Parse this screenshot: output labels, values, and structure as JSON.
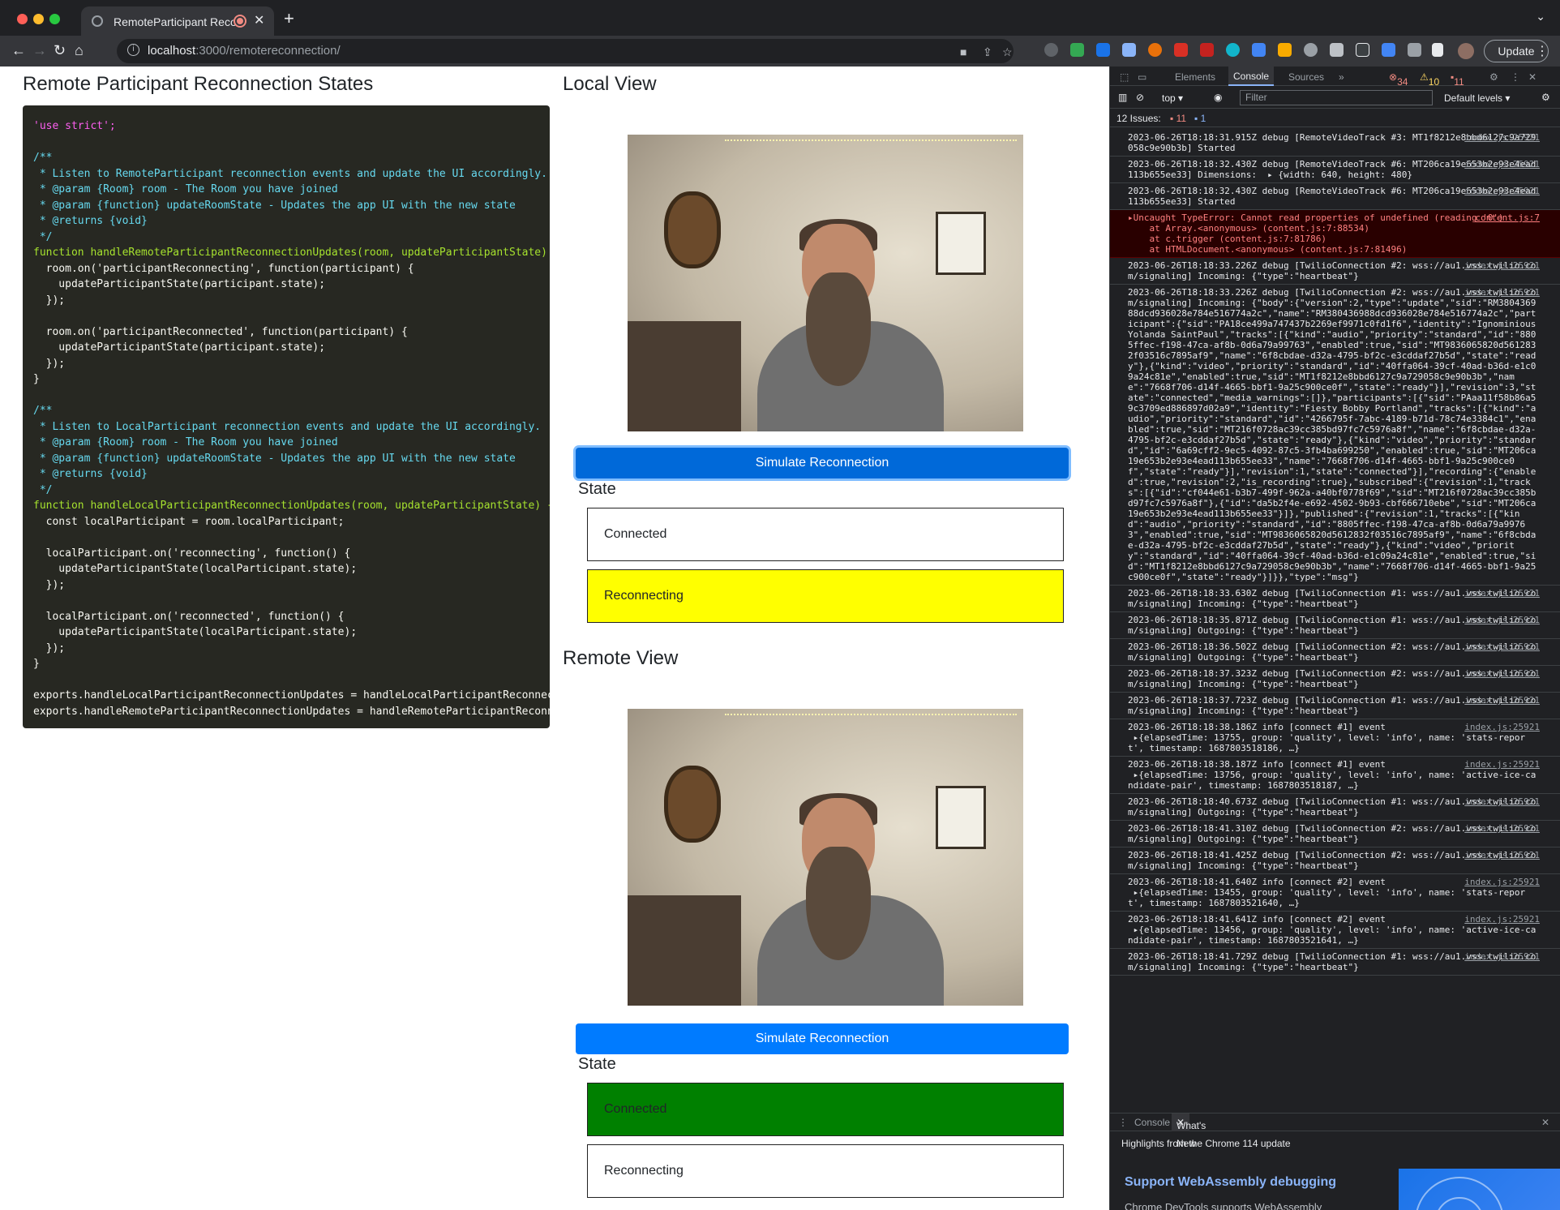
{
  "browser": {
    "tab_title": "RemoteParticipant Reconnection",
    "url_host": "localhost",
    "url_path": ":3000/remotereconnection/",
    "update_label": "Update"
  },
  "page": {
    "title": "Remote Participant Reconnection States",
    "code_lines": [
      "'use strict';",
      "",
      "/**",
      " * Listen to RemoteParticipant reconnection events and update the UI accordingly.",
      " * @param {Room} room - The Room you have joined",
      " * @param {function} updateRoomState - Updates the app UI with the new state",
      " * @returns {void}",
      " */",
      "function handleRemoteParticipantReconnectionUpdates(room, updateParticipantState) {",
      "  room.on('participantReconnecting', function(participant) {",
      "    updateParticipantState(participant.state);",
      "  });",
      "",
      "  room.on('participantReconnected', function(participant) {",
      "    updateParticipantState(participant.state);",
      "  });",
      "}",
      "",
      "/**",
      " * Listen to LocalParticipant reconnection events and update the UI accordingly.",
      " * @param {Room} room - The Room you have joined",
      " * @param {function} updateRoomState - Updates the app UI with the new state",
      " * @returns {void}",
      " */",
      "function handleLocalParticipantReconnectionUpdates(room, updateParticipantState) {",
      "  const localParticipant = room.localParticipant;",
      "",
      "  localParticipant.on('reconnecting', function() {",
      "    updateParticipantState(localParticipant.state);",
      "  });",
      "",
      "  localParticipant.on('reconnected', function() {",
      "    updateParticipantState(localParticipant.state);",
      "  });",
      "}",
      "",
      "exports.handleLocalParticipantReconnectionUpdates = handleLocalParticipantReconnectionUpdates;",
      "exports.handleRemoteParticipantReconnectionUpdates = handleRemoteParticipantReconnectionUpdates;"
    ],
    "local": {
      "heading": "Local View",
      "button": "Simulate Reconnection",
      "state_label": "State",
      "states": [
        {
          "label": "Connected",
          "color": "#ffffff"
        },
        {
          "label": "Reconnecting",
          "color": "#ffff00"
        }
      ]
    },
    "remote": {
      "heading": "Remote View",
      "button": "Simulate Reconnection",
      "state_label": "State",
      "states": [
        {
          "label": "Connected",
          "color": "#008000"
        },
        {
          "label": "Reconnecting",
          "color": "#ffffff"
        }
      ]
    }
  },
  "devtools": {
    "tabs": [
      "Elements",
      "Console",
      "Sources"
    ],
    "active_tab": "Console",
    "errors_count": "34",
    "warnings_count": "10",
    "issues_badge": "11",
    "context": "top",
    "filter_placeholder": "Filter",
    "levels": "Default levels",
    "issues_label": "12 Issues:",
    "issues_err": "11",
    "issues_info": "1",
    "logs": [
      {
        "text": "2023-06-26T18:18:31.915Z debug [RemoteVideoTrack #3: MT1f8212e8bbd6127c9a729058c9e90b3b] Started",
        "src": "index.js:25921",
        "type": "log"
      },
      {
        "text": "2023-06-26T18:18:32.430Z debug [RemoteVideoTrack #6: MT206ca19e653b2e93e4ead113b655ee33] Dimensions:  ▸ {width: 640, height: 480}",
        "src": "index.js:25921",
        "type": "log"
      },
      {
        "text": "2023-06-26T18:18:32.430Z debug [RemoteVideoTrack #6: MT206ca19e653b2e93e4ead113b655ee33] Started",
        "src": "index.js:25921",
        "type": "log"
      },
      {
        "text": "▸Uncaught TypeError: Cannot read properties of undefined (reading '0')\n    at Array.<anonymous> (content.js:7:88534)\n    at c.trigger (content.js:7:81786)\n    at HTMLDocument.<anonymous> (content.js:7:81496)",
        "src": "content.js:7",
        "type": "err"
      },
      {
        "text": "2023-06-26T18:18:33.226Z debug [TwilioConnection #2: wss://au1.vss.twilio.com/signaling] Incoming: {\"type\":\"heartbeat\"}",
        "src": "index.js:25921",
        "type": "log"
      },
      {
        "text": "2023-06-26T18:18:33.226Z debug [TwilioConnection #2: wss://au1.vss.twilio.com/signaling] Incoming: {\"body\":{\"version\":2,\"type\":\"update\",\"sid\":\"RM380436988dcd936028e784e516774a2c\",\"name\":\"RM380436988dcd936028e784e516774a2c\",\"participant\":{\"sid\":\"PA18ce499a747437b2269ef9971c0fd1f6\",\"identity\":\"Ignominious Yolanda SaintPaul\",\"tracks\":[{\"kind\":\"audio\",\"priority\":\"standard\",\"id\":\"8805ffec-f198-47ca-af8b-0d6a79a99763\",\"enabled\":true,\"sid\":\"MT9836065820d5612832f03516c7895af9\",\"name\":\"6f8cbdae-d32a-4795-bf2c-e3cddaf27b5d\",\"state\":\"ready\"},{\"kind\":\"video\",\"priority\":\"standard\",\"id\":\"40ffa064-39cf-40ad-b36d-e1c09a24c81e\",\"enabled\":true,\"sid\":\"MT1f8212e8bbd6127c9a729058c9e90b3b\",\"name\":\"7668f706-d14f-4665-bbf1-9a25c900ce0f\",\"state\":\"ready\"}],\"revision\":3,\"state\":\"connected\",\"media_warnings\":[]},\"participants\":[{\"sid\":\"PAaa11f58b86a59c3709ed886897d02a9\",\"identity\":\"Fiesty Bobby Portland\",\"tracks\":[{\"kind\":\"audio\",\"priority\":\"standard\",\"id\":\"4266795f-7abc-4189-b71d-78c74e3384c1\",\"enabled\":true,\"sid\":\"MT216f0728ac39cc385bd97fc7c5976a8f\",\"name\":\"6f8cbdae-d32a-4795-bf2c-e3cddaf27b5d\",\"state\":\"ready\"},{\"kind\":\"video\",\"priority\":\"standard\",\"id\":\"6a69cff2-9ec5-4092-87c5-3fb4ba699250\",\"enabled\":true,\"sid\":\"MT206ca19e653b2e93e4ead113b655ee33\",\"name\":\"7668f706-d14f-4665-bbf1-9a25c900ce0f\",\"state\":\"ready\"}],\"revision\":1,\"state\":\"connected\"}],\"recording\":{\"enabled\":true,\"revision\":2,\"is_recording\":true},\"subscribed\":{\"revision\":1,\"tracks\":[{\"id\":\"cf044e61-b3b7-499f-962a-a40bf0778f69\",\"sid\":\"MT216f0728ac39cc385bd97fc7c5976a8f\"},{\"id\":\"da5b2f4e-e692-4502-9b93-cbf666710ebe\",\"sid\":\"MT206ca19e653b2e93e4ead113b655ee33\"}]},\"published\":{\"revision\":1,\"tracks\":[{\"kind\":\"audio\",\"priority\":\"standard\",\"id\":\"8805ffec-f198-47ca-af8b-0d6a79a99763\",\"enabled\":true,\"sid\":\"MT9836065820d5612832f03516c7895af9\",\"name\":\"6f8cbdae-d32a-4795-bf2c-e3cddaf27b5d\",\"state\":\"ready\"},{\"kind\":\"video\",\"priority\":\"standard\",\"id\":\"40ffa064-39cf-40ad-b36d-e1c09a24c81e\",\"enabled\":true,\"sid\":\"MT1f8212e8bbd6127c9a729058c9e90b3b\",\"name\":\"7668f706-d14f-4665-bbf1-9a25c900ce0f\",\"state\":\"ready\"}]}},\"type\":\"msg\"}",
        "src": "index.js:25921",
        "type": "log"
      },
      {
        "text": "2023-06-26T18:18:33.630Z debug [TwilioConnection #1: wss://au1.vss.twilio.com/signaling] Incoming: {\"type\":\"heartbeat\"}",
        "src": "index.js:25921",
        "type": "log"
      },
      {
        "text": "2023-06-26T18:18:35.871Z debug [TwilioConnection #1: wss://au1.vss.twilio.com/signaling] Outgoing: {\"type\":\"heartbeat\"}",
        "src": "index.js:25921",
        "type": "log"
      },
      {
        "text": "2023-06-26T18:18:36.502Z debug [TwilioConnection #2: wss://au1.vss.twilio.com/signaling] Outgoing: {\"type\":\"heartbeat\"}",
        "src": "index.js:25921",
        "type": "log"
      },
      {
        "text": "2023-06-26T18:18:37.323Z debug [TwilioConnection #2: wss://au1.vss.twilio.com/signaling] Incoming: {\"type\":\"heartbeat\"}",
        "src": "index.js:25921",
        "type": "log"
      },
      {
        "text": "2023-06-26T18:18:37.723Z debug [TwilioConnection #1: wss://au1.vss.twilio.com/signaling] Incoming: {\"type\":\"heartbeat\"}",
        "src": "index.js:25921",
        "type": "log"
      },
      {
        "text": "2023-06-26T18:18:38.186Z info [connect #1] event\n ▸{elapsedTime: 13755, group: 'quality', level: 'info', name: 'stats-report', timestamp: 1687803518186, …}",
        "src": "index.js:25921",
        "type": "log"
      },
      {
        "text": "2023-06-26T18:18:38.187Z info [connect #1] event\n ▸{elapsedTime: 13756, group: 'quality', level: 'info', name: 'active-ice-candidate-pair', timestamp: 1687803518187, …}",
        "src": "index.js:25921",
        "type": "log"
      },
      {
        "text": "2023-06-26T18:18:40.673Z debug [TwilioConnection #1: wss://au1.vss.twilio.com/signaling] Outgoing: {\"type\":\"heartbeat\"}",
        "src": "index.js:25921",
        "type": "log"
      },
      {
        "text": "2023-06-26T18:18:41.310Z debug [TwilioConnection #2: wss://au1.vss.twilio.com/signaling] Outgoing: {\"type\":\"heartbeat\"}",
        "src": "index.js:25921",
        "type": "log"
      },
      {
        "text": "2023-06-26T18:18:41.425Z debug [TwilioConnection #2: wss://au1.vss.twilio.com/signaling] Incoming: {\"type\":\"heartbeat\"}",
        "src": "index.js:25921",
        "type": "log"
      },
      {
        "text": "2023-06-26T18:18:41.640Z info [connect #2] event\n ▸{elapsedTime: 13455, group: 'quality', level: 'info', name: 'stats-report', timestamp: 1687803521640, …}",
        "src": "index.js:25921",
        "type": "log"
      },
      {
        "text": "2023-06-26T18:18:41.641Z info [connect #2] event\n ▸{elapsedTime: 13456, group: 'quality', level: 'info', name: 'active-ice-candidate-pair', timestamp: 1687803521641, …}",
        "src": "index.js:25921",
        "type": "log"
      },
      {
        "text": "2023-06-26T18:18:41.729Z debug [TwilioConnection #1: wss://au1.vss.twilio.com/signaling] Incoming: {\"type\":\"heartbeat\"}",
        "src": "index.js:25921",
        "type": "log"
      }
    ],
    "drawer": {
      "tabs": [
        "Console",
        "What's New"
      ],
      "active": "What's New",
      "highlights": "Highlights from the Chrome 114 update",
      "title": "Support WebAssembly debugging",
      "body": "Chrome DevTools supports WebAssembly debugging with DWARF information (using an extension)."
    }
  }
}
